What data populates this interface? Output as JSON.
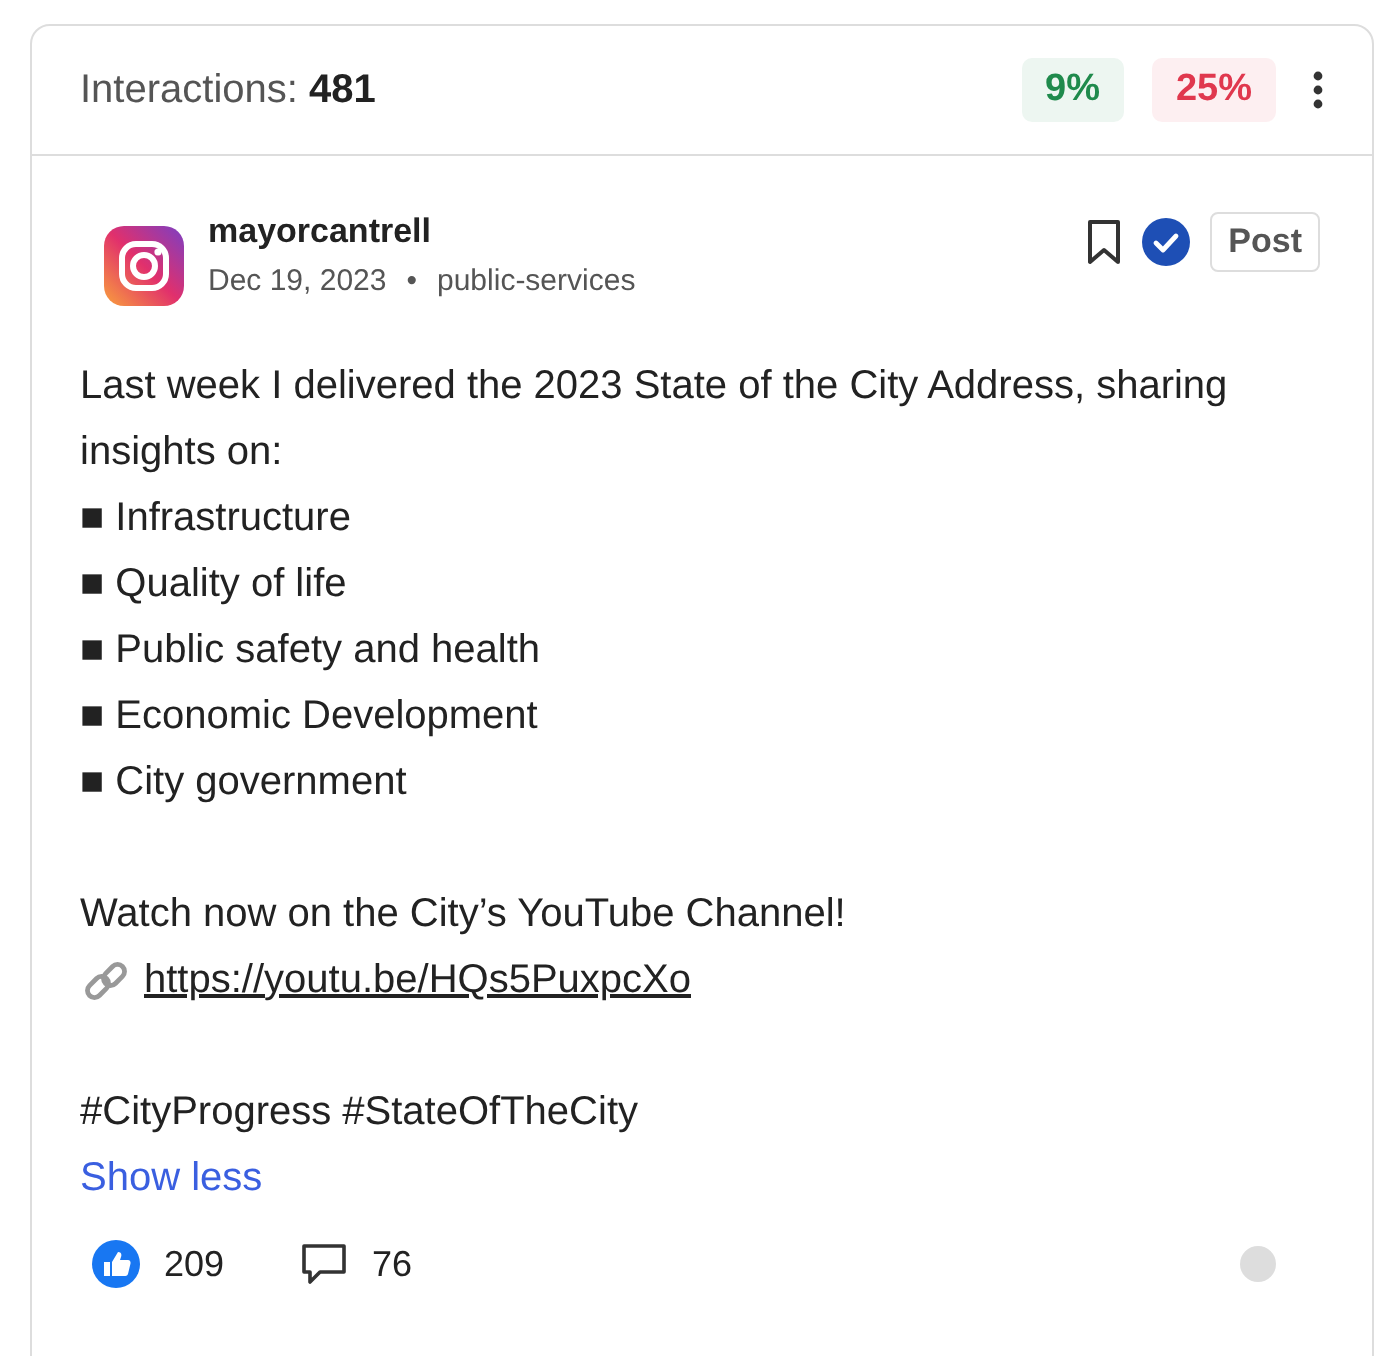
{
  "header": {
    "label": "Interactions:",
    "value": "481",
    "badges": [
      {
        "text": "9%",
        "color": "#1f8a4c"
      },
      {
        "text": "25%",
        "color": "#e0384e"
      }
    ]
  },
  "post": {
    "author": "mayorcantrell",
    "date": "Dec 19, 2023",
    "separator": "•",
    "category": "public-services",
    "type_button": "Post",
    "bookmarked": false,
    "verified": true
  },
  "body": {
    "intro": "Last week I delivered the 2023 State of the City Address, sharing insights on:",
    "bullets": [
      {
        "marker": "■",
        "text": "Infrastructure"
      },
      {
        "marker": "■",
        "text": "Quality of life"
      },
      {
        "marker": "■",
        "text": "Public safety and health"
      },
      {
        "marker": "■",
        "text": "Economic Development"
      },
      {
        "marker": "■",
        "text": "City government"
      }
    ],
    "watch": "Watch now on the City’s YouTube Channel!",
    "link": "https://youtu.be/HQs5PuxpcXo",
    "hashtags": "#CityProgress #StateOfTheCity",
    "toggle": "Show less"
  },
  "footer": {
    "likes": "209",
    "comments": "76"
  }
}
